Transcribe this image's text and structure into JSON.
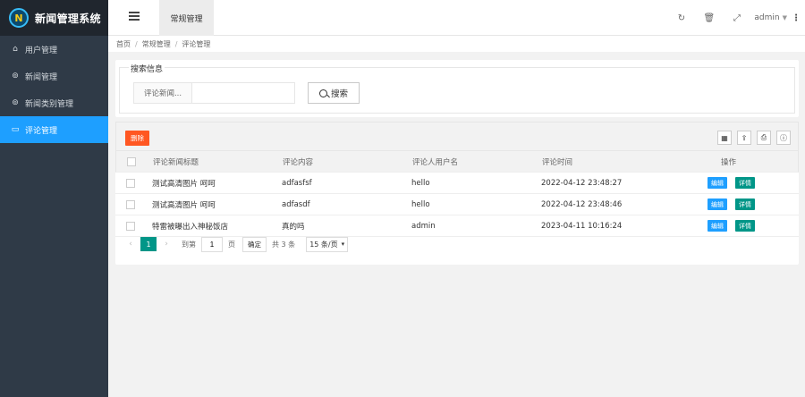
{
  "app": {
    "title": "新闻管理系统",
    "logo_letter": "N"
  },
  "sidebar": {
    "items": [
      {
        "label": "用户管理",
        "icon": "home-icon",
        "glyph": "⌂"
      },
      {
        "label": "新闻管理",
        "icon": "binoculars-icon",
        "glyph": "⊚"
      },
      {
        "label": "新闻类别管理",
        "icon": "binoculars-icon",
        "glyph": "⊚"
      },
      {
        "label": "评论管理",
        "icon": "window-icon",
        "glyph": "▭"
      }
    ],
    "active_index": 3
  },
  "header": {
    "tab_label": "常规管理",
    "user": "admin",
    "icons": {
      "refresh": "↻",
      "trash": "🗑",
      "fullscreen": "⤢",
      "more": "⋮"
    }
  },
  "breadcrumb": {
    "items": [
      "首页",
      "常规管理",
      "评论管理"
    ],
    "sep": "/"
  },
  "search": {
    "legend": "搜索信息",
    "label": "评论新闻...",
    "placeholder": "",
    "value": "",
    "button_label": "搜索"
  },
  "toolbar": {
    "delete_label": "删除",
    "icons": {
      "columns": "▦",
      "export": "⇪",
      "print": "⎙",
      "info": "ⓘ"
    }
  },
  "table": {
    "columns": [
      "评论新闻标题",
      "评论内容",
      "评论人用户名",
      "评论时间",
      "操作"
    ],
    "rows": [
      {
        "title": "测试高清图片 呵呵",
        "content": "adfasfsf",
        "user": "hello",
        "time": "2022-04-12 23:48:27"
      },
      {
        "title": "测试高清图片 呵呵",
        "content": "adfasdf",
        "user": "hello",
        "time": "2022-04-12 23:48:46"
      },
      {
        "title": "特雷被曝出入神秘饭店",
        "content": "真的吗",
        "user": "admin",
        "time": "2023-04-11 10:16:24"
      }
    ],
    "edit_label": "编辑",
    "detail_label": "详情"
  },
  "pager": {
    "prev": "‹",
    "next": "›",
    "current": "1",
    "goto_label": "到第",
    "goto_value": "1",
    "page_label": "页",
    "confirm_label": "确定",
    "total_text": "共 3 条",
    "per_page": "15 条/页"
  }
}
